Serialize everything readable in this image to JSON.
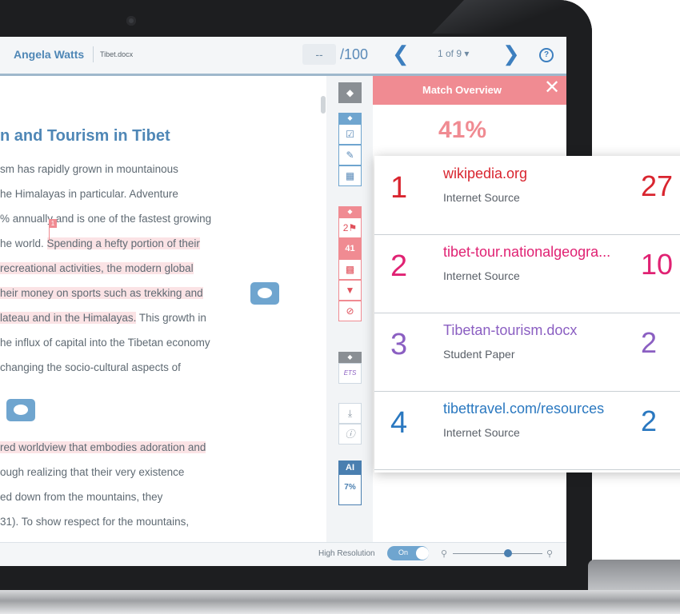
{
  "header": {
    "student_name": "Angela Watts",
    "doc_name": "Tibet.docx",
    "score": "--",
    "score_total": "/100",
    "prev_icon": "chevron-left-icon",
    "pager": "1 of 9 ▾",
    "next_icon": "chevron-right-icon",
    "help": "?"
  },
  "document": {
    "title": "n and Tourism in Tibet",
    "lines": [
      {
        "pre": "sm has rapidly grown in mountainous",
        "hl": ""
      },
      {
        "pre": "he Himalayas in particular. Adventure",
        "hl": ""
      },
      {
        "pre": "% annually and is one of the fastest growing",
        "hl": ""
      },
      {
        "pre": "he world. ",
        "hl": "Spending a hefty portion of their"
      },
      {
        "pre": "",
        "hl": "recreational activities, the modern global"
      },
      {
        "pre": "",
        "hl": "heir money on sports such as trekking and"
      },
      {
        "pre": "",
        "hl": "lateau and in the Himalayas.",
        "post": " This growth in"
      },
      {
        "pre": "he influx of capital into the Tibetan economy",
        "hl": ""
      },
      {
        "pre": "changing the socio-cultural aspects of",
        "hl": ""
      },
      {
        "pre": "",
        "hl": "red worldview that embodies adoration and"
      },
      {
        "pre": "ough realizing that their very existence",
        "hl": ""
      },
      {
        "pre": "ed down from the mountains, they",
        "hl": ""
      },
      {
        "pre": " 31). To show respect for the mountains,",
        "hl": ""
      }
    ],
    "marker": "1"
  },
  "toolbar": {
    "layers_icon": "layers-icon",
    "similarity_count": "2",
    "match_percent": "41",
    "ets_label": "ETS",
    "ai_label": "AI",
    "ai_value": "7%"
  },
  "match_overview": {
    "title": "Match Overview",
    "close": "✕",
    "percent": "41%",
    "sources": [
      {
        "rank": "1",
        "name": "wikipedia.org",
        "type": "Internet Source",
        "pct": "27",
        "color": "#d9252f"
      },
      {
        "rank": "2",
        "name": "tibet-tour.nationalgeogra...",
        "type": "Internet Source",
        "pct": "10",
        "color": "#e02273"
      },
      {
        "rank": "3",
        "name": "Tibetan-tourism.docx",
        "type": "Student Paper",
        "pct": "2",
        "color": "#8b5fc2"
      },
      {
        "rank": "4",
        "name": "tibettravel.com/resources",
        "type": "Internet Source",
        "pct": "2",
        "color": "#2a78c0"
      }
    ]
  },
  "footer": {
    "high_resolution": "High Resolution",
    "toggle": "On",
    "zoom_out_icon": "zoom-out-icon",
    "zoom_in_icon": "zoom-in-icon"
  }
}
